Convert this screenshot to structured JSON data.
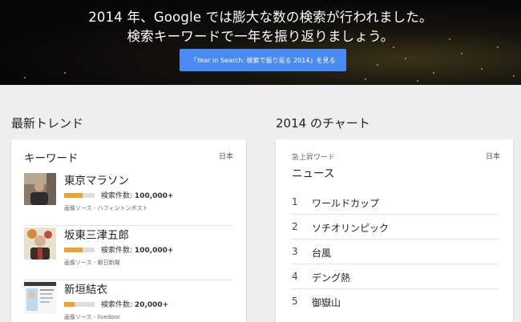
{
  "hero": {
    "line1": "2014 年、Google では膨大な数の検索が行われました。",
    "line2": "検索キーワードで一年を振り返りましょう。",
    "button_label": "「Year in Search: 検索で振り返る 2014」を見る"
  },
  "trending": {
    "section_title": "最新トレンド",
    "card_title": "キーワード",
    "country": "日本",
    "items": [
      {
        "name": "東京マラソン",
        "count_label": "検索件数:",
        "count": "100,000+",
        "popularity": 0.6,
        "source": "画像ソース - ハフィントンポスト",
        "thumbnail_icon": "portrait-photo-icon"
      },
      {
        "name": "坂東三津五郎",
        "count_label": "検索件数:",
        "count": "100,000+",
        "popularity": 0.6,
        "source": "画像ソース - 朝日新聞",
        "thumbnail_icon": "portrait-photo-icon"
      },
      {
        "name": "新垣結衣",
        "count_label": "検索件数:",
        "count": "20,000+",
        "popularity": 0.35,
        "source": "画像ソース - livedoor",
        "thumbnail_icon": "webpage-photo-icon"
      }
    ],
    "bar_color": "#f2a030"
  },
  "charts": {
    "section_title": "2014 のチャート",
    "subtitle": "急上昇ワード",
    "card_title": "ニュース",
    "country": "日本",
    "items": [
      {
        "rank": "1",
        "label": "ワールドカップ"
      },
      {
        "rank": "2",
        "label": "ソチオリンピック"
      },
      {
        "rank": "3",
        "label": "台風"
      },
      {
        "rank": "4",
        "label": "デング熱"
      },
      {
        "rank": "5",
        "label": "御嶽山"
      }
    ]
  },
  "colors": {
    "accent": "#4a8af4",
    "background": "#eeeeee"
  }
}
